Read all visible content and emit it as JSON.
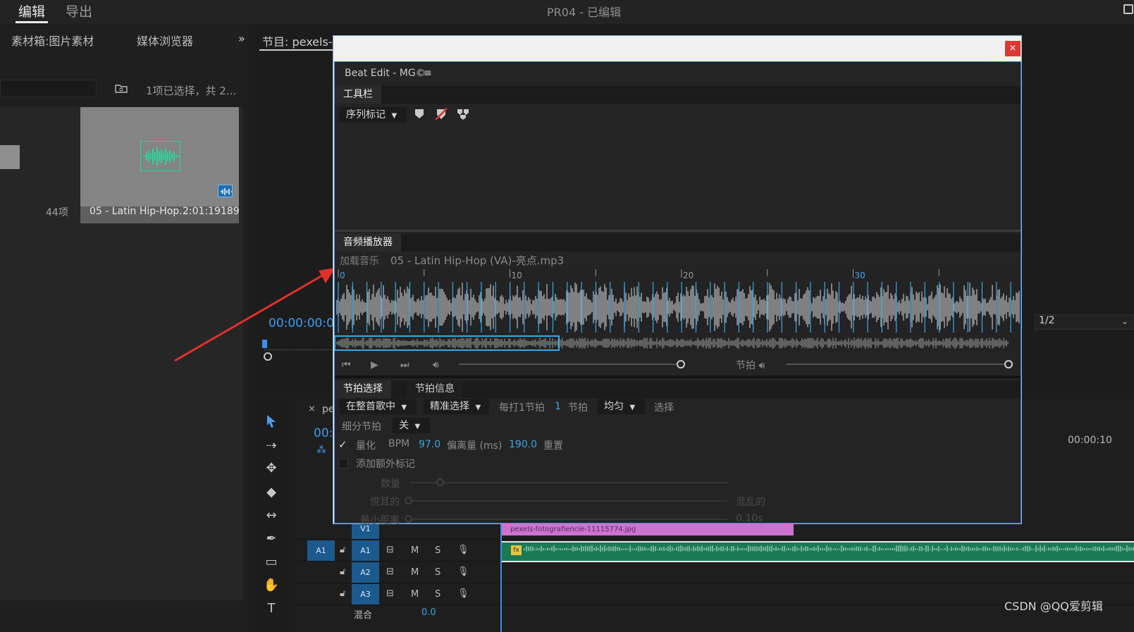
{
  "topbar": {
    "tab_edit": "编辑",
    "tab_export": "导出",
    "project_title": "PR04 - 已编辑"
  },
  "project_panel": {
    "tab1": "素材箱:图片素材",
    "tab2": "媒体浏览器",
    "more": "»",
    "selection_info": "1项已选择，共 2...",
    "items_count": "44项",
    "thumb_name": "05 - Latin Hip-Hop...",
    "thumb_duration": "2:01:19189"
  },
  "monitor": {
    "tab": "节目: pexels-fot",
    "timecode": "00:00:00:00",
    "ratio": "1/2"
  },
  "timeline": {
    "close": "×",
    "tab": "pex",
    "timecode": "00:0",
    "time_right": "00:00:10",
    "tracks": [
      {
        "name": "V1"
      },
      {
        "name": "A1",
        "src": "A1",
        "m": "M",
        "s": "S"
      },
      {
        "name": "A2",
        "m": "M",
        "s": "S"
      },
      {
        "name": "A3",
        "m": "M",
        "s": "S"
      }
    ],
    "mix_label": "混合",
    "mix_value": "0.0",
    "video_clip": "pexels-fotografiencie-11115774.jpg",
    "fx": "fx"
  },
  "dialog": {
    "close": "×",
    "title": "Beat Edit - MG©",
    "menu_icon": "≡",
    "toolbar_tab": "工具栏",
    "seq_marker_dropdown": "序列标记",
    "audio_tab": "音频播放器",
    "load_music": "加载音乐",
    "music_file": "05 - Latin Hip-Hop (VA)-亮点.mp3",
    "ruler": {
      "labels": [
        "0",
        "10",
        "20",
        "30"
      ]
    },
    "beat_volume_label": "节拍",
    "beat_select_tab": "节拍选择",
    "beat_info_tab": "节拍信息",
    "scope_dropdown": "在整首歌中",
    "precise_dropdown": "精准选择",
    "every_label": "每打1节拍",
    "every_value": "1",
    "beat_unit": "节拍",
    "even_dropdown": "均匀",
    "select_label": "选择",
    "subdivide_label": "细分节拍",
    "subdivide_value": "关",
    "quantize_label": "量化",
    "bpm_label": "BPM",
    "bpm_value": "97.0",
    "offset_label": "偏离量 (ms)",
    "offset_value": "190.0",
    "reset_label": "重置",
    "extra_marker_label": "添加额外标记",
    "count_label": "数量",
    "pleasant_label": "悦耳的",
    "chaotic_label": "混乱的",
    "min_dist_label": "最小距离",
    "min_dist_value": "0.10s"
  },
  "watermark": "CSDN @QQ爱剪辑",
  "colors": {
    "accent": "#3aa8e6",
    "arrow": "#e0302a",
    "clip_video": "#cc72cf",
    "clip_audio": "#1a7a56"
  }
}
